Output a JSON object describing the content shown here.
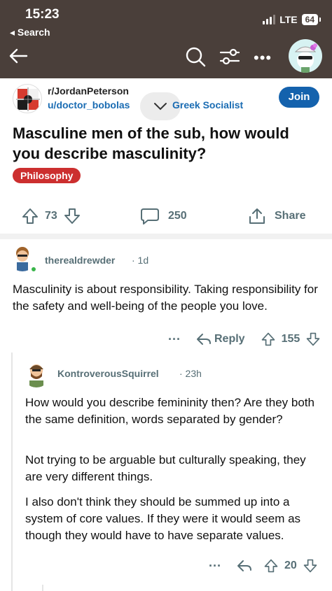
{
  "status_bar": {
    "time": "15:23",
    "back_label": "◂ Search",
    "network": "LTE",
    "battery": "64"
  },
  "nav": {
    "icons": [
      "back-arrow-icon",
      "search-icon",
      "filter-icon",
      "more-icon",
      "avatar"
    ]
  },
  "post": {
    "subreddit": "r/JordanPeterson",
    "author": "u/doctor_bobolas",
    "user_flair": "Greek Socialist",
    "join_label": "Join",
    "title": "Masculine men of the sub, how would you describe masculinity?",
    "flair": "Philosophy",
    "upvotes": "73",
    "comments": "250",
    "share_label": "Share"
  },
  "comments": [
    {
      "user": "therealdrewder",
      "time": "· 1d",
      "body": "Masculinity is about responsibility. Taking responsibility for the safety and well-being of the people you love.",
      "more": "···",
      "reply_label": "Reply",
      "votes": "155"
    },
    {
      "user": "KontroverousSquirrel",
      "time": "· 23h",
      "paragraphs": [
        "How would you describe femininity then? Are they both the same definition, words separated by gender?",
        "Not trying to be arguable but culturally speaking, they are very different things.",
        "I also don't think they should be summed up into a system of core values. If they were it would seem as though they would have to have separate values."
      ],
      "more": "···",
      "votes": "20"
    }
  ],
  "colors": {
    "top_bar": "#4a3f3a",
    "join": "#1462ad",
    "flair": "#cc2f2f",
    "author_link": "#1a6cb3",
    "meta": "#576f76"
  }
}
